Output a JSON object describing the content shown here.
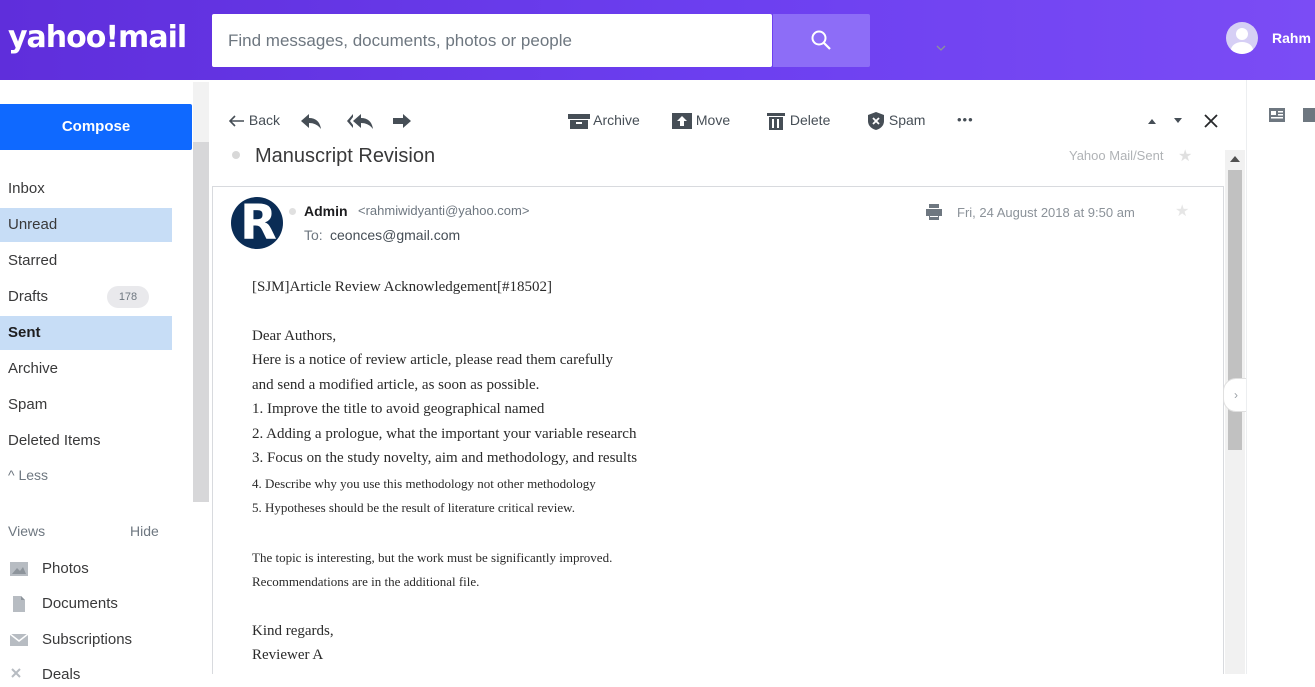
{
  "header": {
    "logo": "yahoo!mail",
    "search_placeholder": "Find messages, documents, photos or people",
    "username": "Rahm"
  },
  "sidebar": {
    "compose_label": "Compose",
    "folders": [
      {
        "label": "Inbox"
      },
      {
        "label": "Unread"
      },
      {
        "label": "Starred"
      },
      {
        "label": "Drafts",
        "count": "178"
      },
      {
        "label": "Sent"
      },
      {
        "label": "Archive"
      },
      {
        "label": "Spam"
      },
      {
        "label": "Deleted Items"
      }
    ],
    "less_label": "^ Less",
    "views_label": "Views",
    "hide_label": "Hide",
    "views": [
      {
        "label": "Photos",
        "icon": "photos-icon"
      },
      {
        "label": "Documents",
        "icon": "documents-icon"
      },
      {
        "label": "Subscriptions",
        "icon": "subscriptions-icon"
      },
      {
        "label": "Deals",
        "icon": "deals-icon"
      }
    ]
  },
  "toolbar": {
    "back_label": "Back",
    "archive_label": "Archive",
    "move_label": "Move",
    "delete_label": "Delete",
    "spam_label": "Spam",
    "more_label": "•••"
  },
  "message": {
    "subject": "Manuscript Revision",
    "folder_tag": "Yahoo Mail/Sent",
    "sender_name": "Admin",
    "sender_email": "<rahmiwidyanti@yahoo.com>",
    "to_label": "To:",
    "to_email": "ceonces@gmail.com",
    "date": "Fri, 24 August 2018 at 9:50 am",
    "body": {
      "ref": "[SJM]Article Review Acknowledgement[#18502]",
      "greeting": "Dear Authors,",
      "p1": "Here is a notice of review article, please read them carefully",
      "p2": "and send a modified article, as soon as possible.",
      "item1": "1.  Improve the title to avoid  geographical named",
      "item2": "2.  Adding a prologue, what the important your variable research",
      "item3": "3.  Focus on the study novelty, aim and methodology, and results",
      "item4": "4.  Describe why you use this methodology not other methodology",
      "item5": "5.  Hypotheses should be the result of literature critical review.",
      "c1": "The topic is interesting, but the work must be significantly improved.",
      "c2": "Recommendations are in the additional file.",
      "closing": "Kind regards,",
      "signature": "Reviewer A"
    }
  },
  "colors": {
    "header_bg": "#6c3ff0",
    "compose_bg": "#0f69ff",
    "selected_bg": "#c7ddf6"
  }
}
